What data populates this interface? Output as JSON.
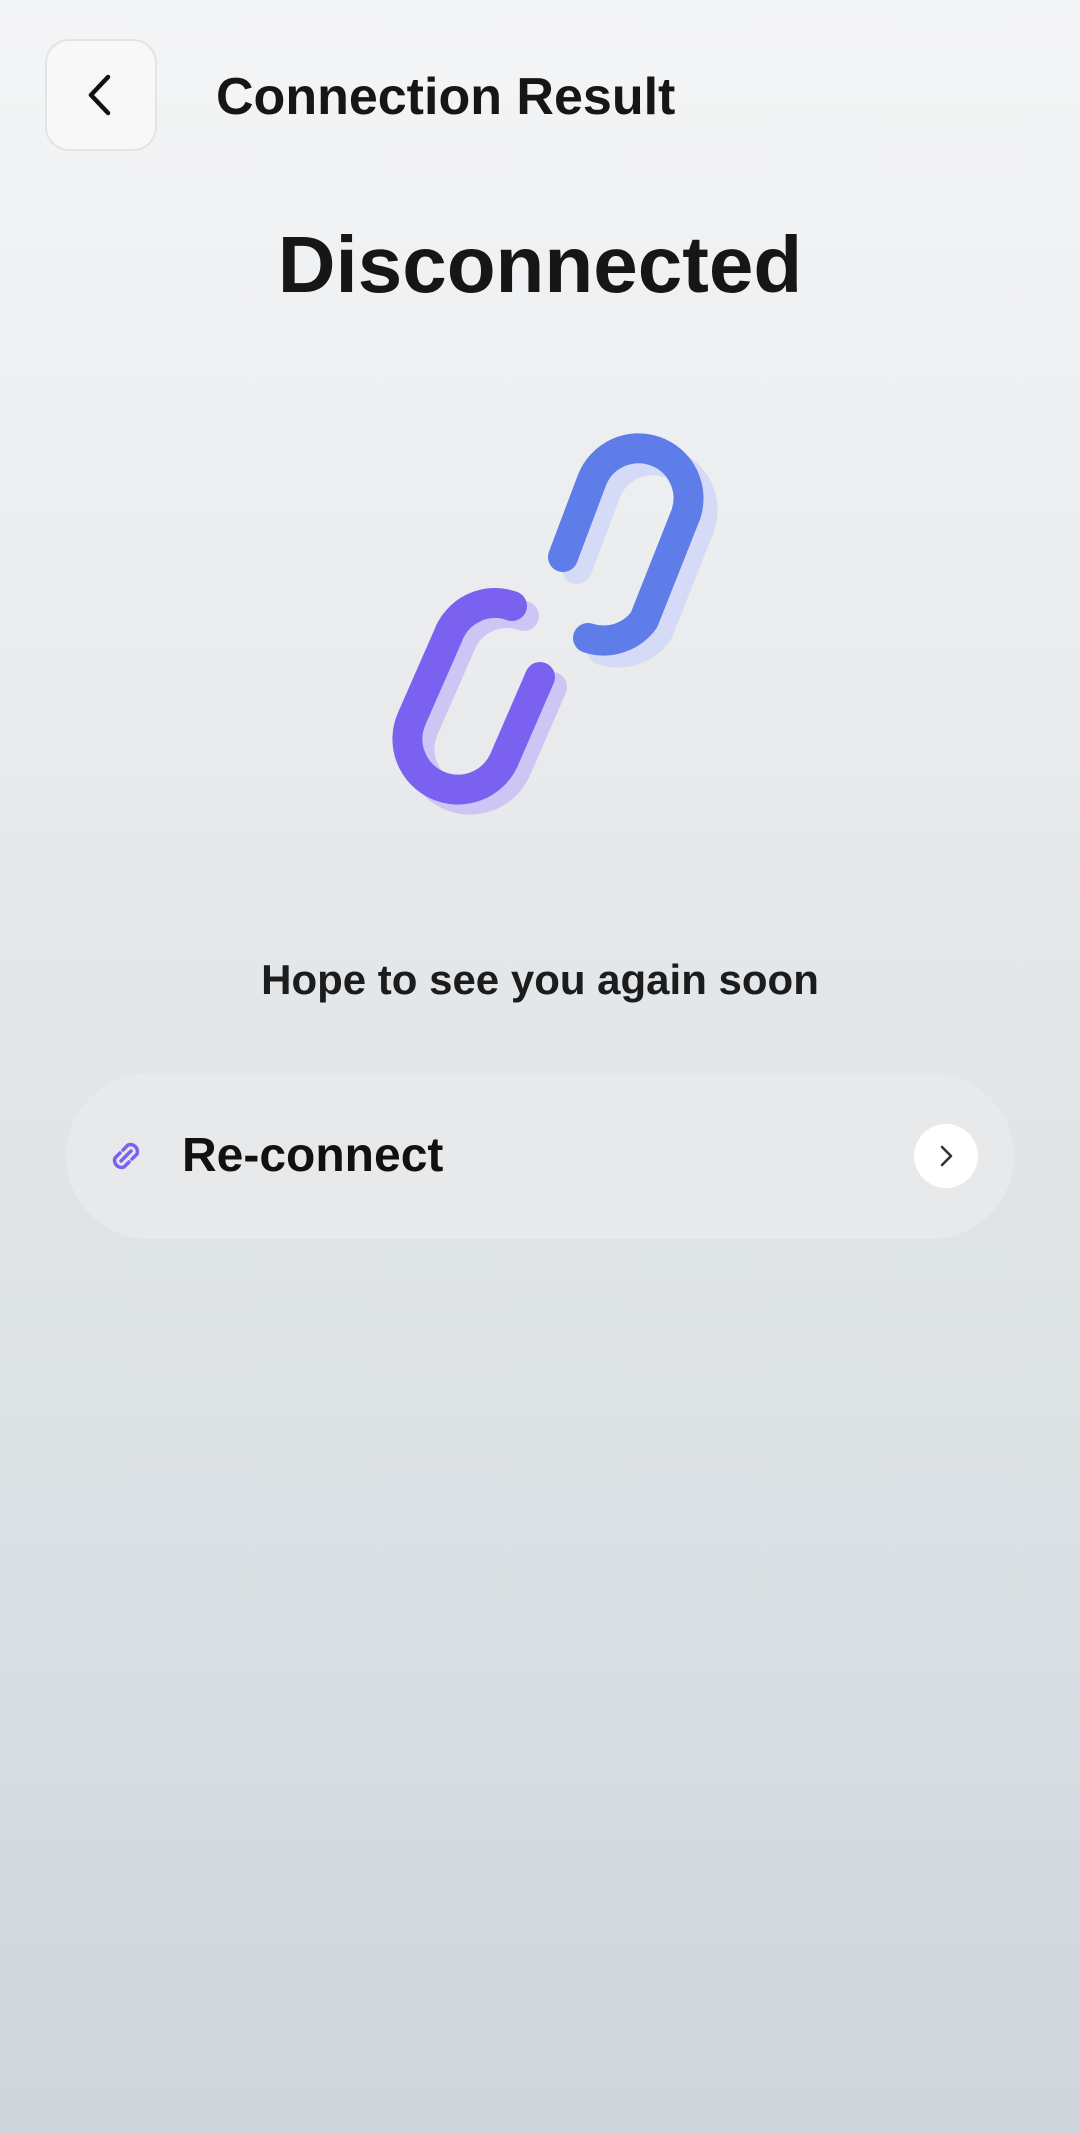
{
  "header": {
    "title": "Connection Result",
    "back_icon": "chevron-left-icon"
  },
  "status": {
    "title": "Disconnected",
    "illustration_icon": "broken-link-icon",
    "message": "Hope to see you again soon"
  },
  "reconnect": {
    "label": "Re-connect",
    "icon": "link-icon",
    "arrow_icon": "chevron-right-icon"
  },
  "colors": {
    "purple": "#7b61f0",
    "blue": "#5f7de8",
    "purple_shadow": "#cdc6f4",
    "blue_shadow": "#d5dbf6"
  }
}
